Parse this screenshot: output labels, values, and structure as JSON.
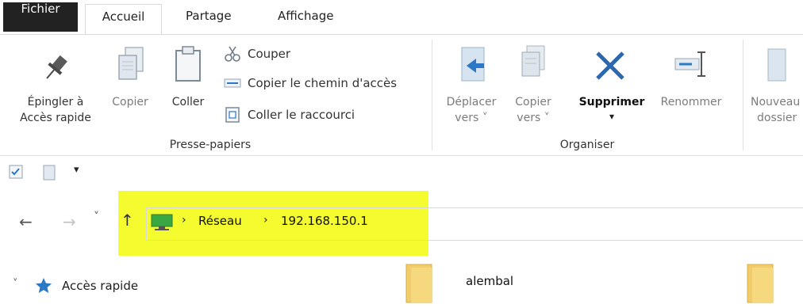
{
  "tabs": {
    "file": "Fichier",
    "home": "Accueil",
    "share": "Partage",
    "view": "Affichage"
  },
  "ribbon": {
    "clipboard": {
      "pin_line1": "Épingler à",
      "pin_line2": "Accès rapide",
      "copy": "Copier",
      "paste": "Coller",
      "cut": "Couper",
      "copy_path": "Copier le chemin d'accès",
      "paste_shortcut": "Coller le raccourci",
      "group_label": "Presse-papiers"
    },
    "organize": {
      "move_line1": "Déplacer",
      "move_line2": "vers ˅",
      "copyto_line1": "Copier",
      "copyto_line2": "vers ˅",
      "delete": "Supprimer",
      "delete_arrow": "▾",
      "rename": "Renommer",
      "group_label": "Organiser"
    },
    "new": {
      "newfolder_line1": "Nouveau",
      "newfolder_line2": "dossier"
    }
  },
  "qat": {
    "dropdown": "▾"
  },
  "address": {
    "back": "←",
    "forward": "→",
    "recent": "˅",
    "up": "↑",
    "crumbs": [
      "Réseau",
      "192.168.150.1"
    ],
    "separator": "›",
    "highlight_color": "#f4fb2f"
  },
  "navigation": {
    "expand": "˅",
    "quick_access": "Accès rapide"
  },
  "files": [
    "alembal"
  ],
  "colors": {
    "accent": "#2b78c5",
    "delete_x": "#2c67b0"
  }
}
